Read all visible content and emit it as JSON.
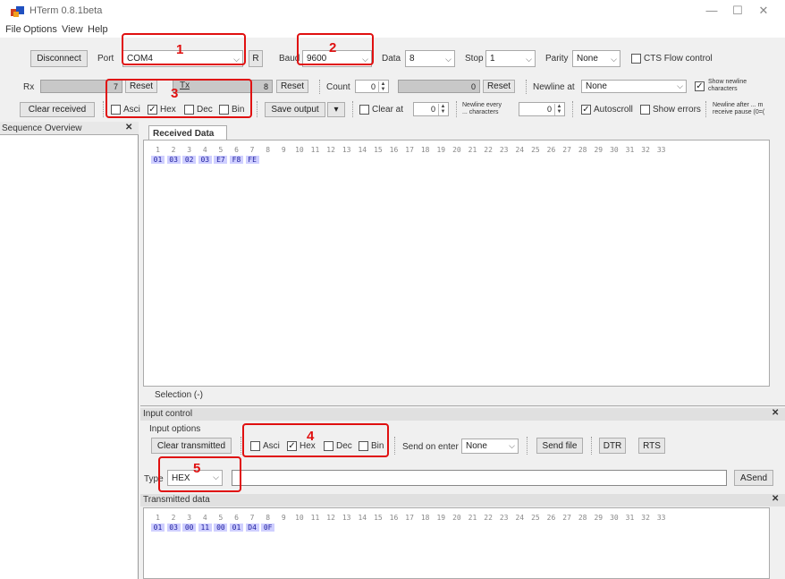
{
  "window": {
    "title": "HTerm 0.8.1beta",
    "controls": [
      "—",
      "☐",
      "✕"
    ]
  },
  "menu": [
    "File",
    "Options",
    "View",
    "Help"
  ],
  "connection": {
    "disconnect": "Disconnect",
    "port_label": "Port",
    "port_value": "COM4",
    "refresh": "R",
    "baud_label": "Baud",
    "baud_value": "9600",
    "data_label": "Data",
    "data_value": "8",
    "stop_label": "Stop",
    "stop_value": "1",
    "parity_label": "Parity",
    "parity_value": "None",
    "cts_label": "CTS Flow control"
  },
  "rxtx": {
    "rx_label": "Rx",
    "rx_count": "7",
    "reset": "Reset",
    "tx_label": "Tx",
    "tx_count": "8",
    "count_label": "Count",
    "count_value": "0",
    "count_field": "0",
    "newline_label": "Newline at",
    "newline_value": "None",
    "show_newline_1": "Show newline",
    "show_newline_2": "characters"
  },
  "receive_opts": {
    "clear_received": "Clear received",
    "asci": "Asci",
    "hex": "Hex",
    "dec": "Dec",
    "bin": "Bin",
    "save_output": "Save output",
    "clear_at": "Clear at",
    "clear_at_value": "0",
    "newline_every_1": "Newline every",
    "newline_every_2": "... characters",
    "newline_every_value": "0",
    "autoscroll": "Autoscroll",
    "show_errors": "Show errors",
    "newline_after_1": "Newline after ... m",
    "newline_after_2": "receive pause (0=("
  },
  "sequence": {
    "title": "Sequence Overview",
    "close": "✕"
  },
  "received": {
    "tab": "Received Data",
    "indices": [
      "1",
      "2",
      "3",
      "4",
      "5",
      "6",
      "7",
      "8",
      "9",
      "10",
      "11",
      "12",
      "13",
      "14",
      "15",
      "16",
      "17",
      "18",
      "19",
      "20",
      "21",
      "22",
      "23",
      "24",
      "25",
      "26",
      "27",
      "28",
      "29",
      "30",
      "31",
      "32",
      "33"
    ],
    "bytes": [
      "01",
      "03",
      "02",
      "03",
      "E7",
      "F8",
      "FE"
    ],
    "selection": "Selection (-)"
  },
  "input": {
    "header": "Input control",
    "close": "✕",
    "options_label": "Input options",
    "clear_transmitted": "Clear transmitted",
    "asci": "Asci",
    "hex": "Hex",
    "dec": "Dec",
    "bin": "Bin",
    "send_on_enter_label": "Send on enter",
    "send_on_enter_value": "None",
    "send_file": "Send file",
    "dtr": "DTR",
    "rts": "RTS",
    "type_label": "Type",
    "type_value": "HEX",
    "asend": "ASend"
  },
  "transmitted": {
    "header": "Transmitted data",
    "close": "✕",
    "bytes": [
      "01",
      "03",
      "00",
      "11",
      "00",
      "01",
      "D4",
      "0F"
    ]
  },
  "annotations": [
    "1",
    "2",
    "3",
    "4",
    "5"
  ],
  "accent_color": "#e01010"
}
